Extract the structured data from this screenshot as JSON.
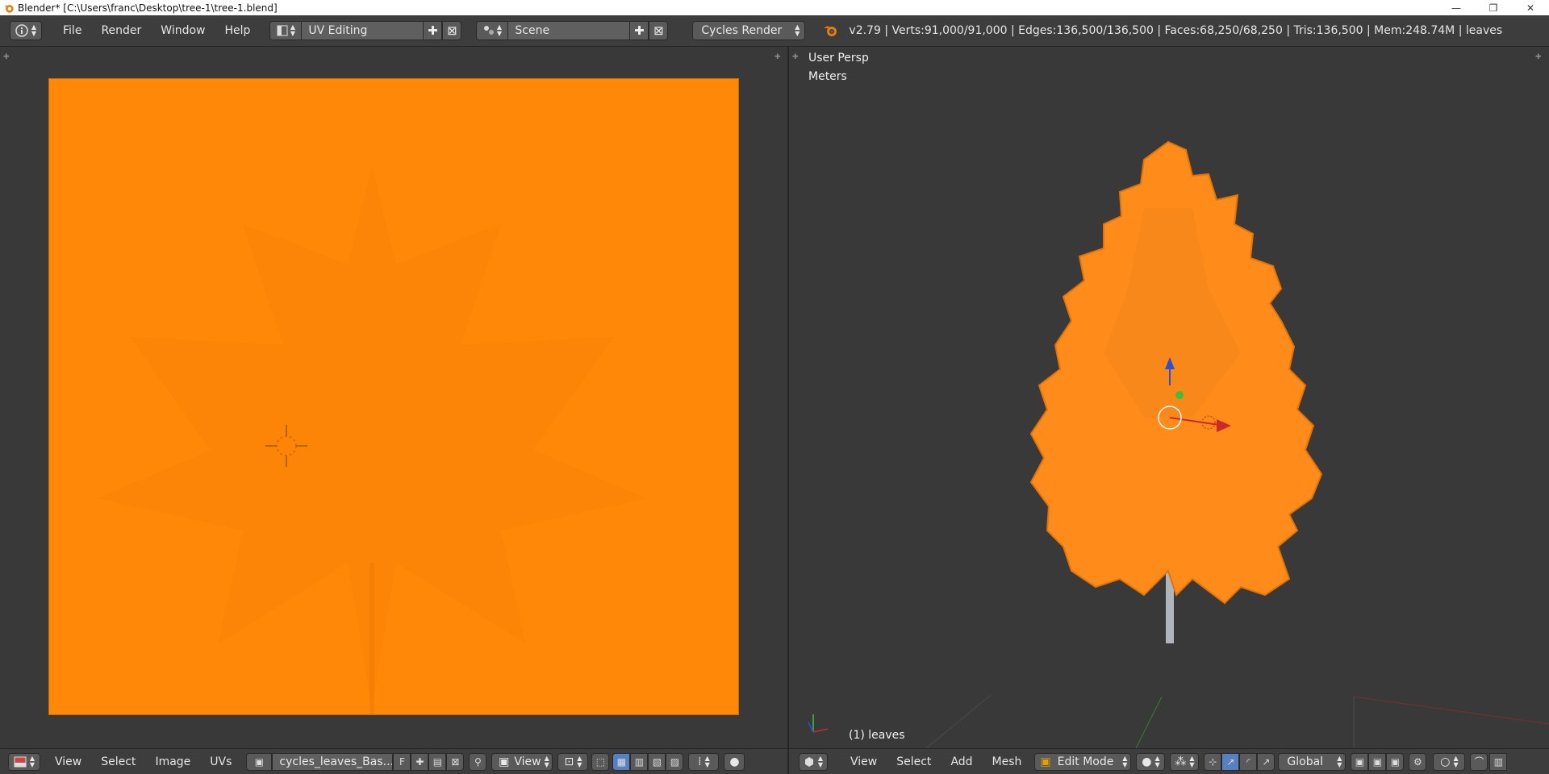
{
  "window": {
    "title": "Blender* [C:\\Users\\franc\\Desktop\\tree-1\\tree-1.blend]",
    "controls": [
      "—",
      "❐",
      "✕"
    ]
  },
  "info_header": {
    "menus": [
      "File",
      "Render",
      "Window",
      "Help"
    ],
    "screen_layout": "UV Editing",
    "scene": "Scene",
    "render_engine": "Cycles Render",
    "stats": "v2.79 | Verts:91,000/91,000 | Edges:136,500/136,500 | Faces:68,250/68,250 | Tris:136,500 | Mem:248.74M | leaves"
  },
  "uv_editor": {
    "menus": [
      "View",
      "Select",
      "Image",
      "UVs"
    ],
    "image_name": "cycles_leaves_Bas...",
    "fake_user": "F",
    "view_mode": "View",
    "image_color": "#ff8808"
  },
  "viewport": {
    "view_label": "User Persp",
    "units_label": "Meters",
    "object_label": "(1) leaves",
    "menus": [
      "View",
      "Select",
      "Add",
      "Mesh"
    ],
    "mode": "Edit Mode",
    "orientation": "Global",
    "leaf_color": "#ff8c1a",
    "trunk_color": "#b0b4bc"
  },
  "colors": {
    "background": "#393939",
    "header": "#3d3d3d",
    "button": "#5a5a5a",
    "accent": "#5680c2"
  }
}
